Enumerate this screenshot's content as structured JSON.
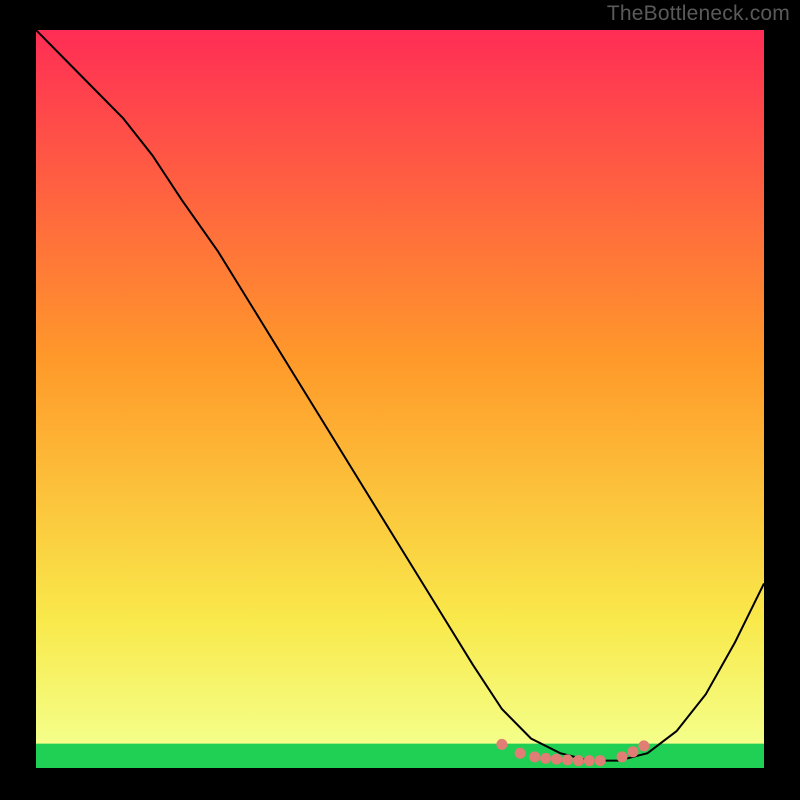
{
  "watermark": "TheBottleneck.com",
  "chart_data": {
    "type": "line",
    "title": "",
    "xlabel": "",
    "ylabel": "",
    "xlim": [
      0,
      100
    ],
    "ylim": [
      0,
      100
    ],
    "grid": false,
    "legend": false,
    "series": [
      {
        "name": "curve",
        "stroke": "#000000",
        "stroke_width": 2,
        "x": [
          0,
          4,
          8,
          12,
          16,
          20,
          25,
          30,
          35,
          40,
          45,
          50,
          55,
          60,
          64,
          68,
          72,
          76,
          80,
          84,
          88,
          92,
          96,
          100
        ],
        "y": [
          100,
          96,
          92,
          88,
          83,
          77,
          70,
          62,
          54,
          46,
          38,
          30,
          22,
          14,
          8,
          4,
          2,
          1,
          1,
          2,
          5,
          10,
          17,
          25
        ]
      },
      {
        "name": "green-band",
        "type": "band",
        "y_from": 0,
        "y_to": 3.3
      },
      {
        "name": "markers",
        "type": "scatter",
        "color": "#e07d74",
        "x": [
          64.0,
          66.5,
          68.5,
          70.0,
          71.5,
          73.0,
          74.5,
          76.0,
          77.5,
          80.5,
          82.0,
          83.5
        ],
        "y": [
          3.2,
          2.0,
          1.5,
          1.3,
          1.2,
          1.1,
          1.0,
          1.0,
          1.0,
          1.5,
          2.2,
          3.0
        ]
      }
    ],
    "background_gradient": {
      "top": "#ff2d55",
      "mid1": "#ff9a2a",
      "mid2": "#f9e94b",
      "bottom": "#31e65f"
    }
  }
}
